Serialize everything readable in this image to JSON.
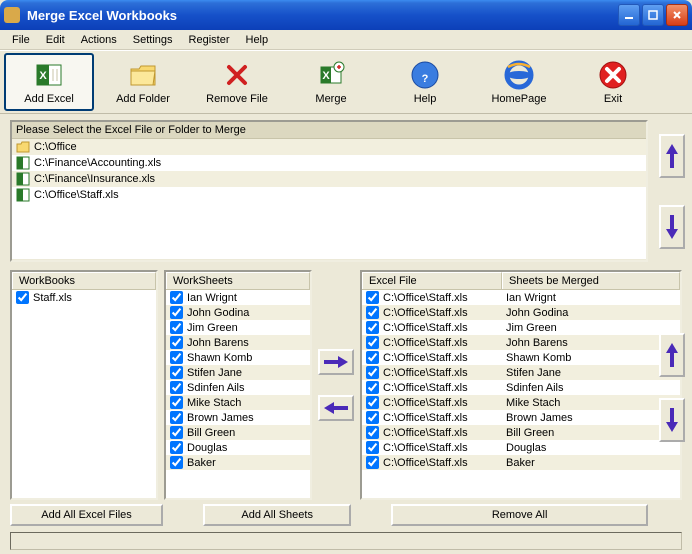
{
  "window": {
    "title": "Merge Excel Workbooks"
  },
  "menu": [
    "File",
    "Edit",
    "Actions",
    "Settings",
    "Register",
    "Help"
  ],
  "toolbar": [
    {
      "label": "Add Excel",
      "icon": "excel-add-icon"
    },
    {
      "label": "Add Folder",
      "icon": "folder-icon"
    },
    {
      "label": "Remove File",
      "icon": "remove-icon"
    },
    {
      "label": "Merge",
      "icon": "excel-merge-icon"
    },
    {
      "label": "Help",
      "icon": "help-icon"
    },
    {
      "label": "HomePage",
      "icon": "ie-icon"
    },
    {
      "label": "Exit",
      "icon": "exit-icon"
    }
  ],
  "file_panel": {
    "header": "Please Select the Excel File or Folder to Merge",
    "items": [
      {
        "label": "C:\\Office",
        "type": "folder"
      },
      {
        "label": "C:\\Finance\\Accounting.xls",
        "type": "xls"
      },
      {
        "label": "C:\\Finance\\Insurance.xls",
        "type": "xls"
      },
      {
        "label": "C:\\Office\\Staff.xls",
        "type": "xls"
      }
    ]
  },
  "workbooks": {
    "header": "WorkBooks",
    "items": [
      {
        "label": "Staff.xls",
        "checked": true
      }
    ]
  },
  "worksheets": {
    "header": "WorkSheets",
    "items": [
      {
        "label": "Ian Wrignt",
        "checked": true
      },
      {
        "label": "John Godina",
        "checked": true
      },
      {
        "label": "Jim Green",
        "checked": true
      },
      {
        "label": "John Barens",
        "checked": true
      },
      {
        "label": "Shawn Komb",
        "checked": true
      },
      {
        "label": "Stifen Jane",
        "checked": true
      },
      {
        "label": "Sdinfen Ails",
        "checked": true
      },
      {
        "label": "Mike Stach",
        "checked": true
      },
      {
        "label": "Brown James",
        "checked": true
      },
      {
        "label": "Bill Green",
        "checked": true
      },
      {
        "label": "Douglas",
        "checked": true
      },
      {
        "label": "Baker",
        "checked": true
      }
    ]
  },
  "merge": {
    "header_excel": "Excel File",
    "header_sheets": "Sheets be Merged",
    "items": [
      {
        "file": "C:\\Office\\Staff.xls",
        "sheet": "Ian Wrignt",
        "checked": true
      },
      {
        "file": "C:\\Office\\Staff.xls",
        "sheet": "John Godina",
        "checked": true
      },
      {
        "file": "C:\\Office\\Staff.xls",
        "sheet": "Jim Green",
        "checked": true
      },
      {
        "file": "C:\\Office\\Staff.xls",
        "sheet": "John Barens",
        "checked": true
      },
      {
        "file": "C:\\Office\\Staff.xls",
        "sheet": "Shawn Komb",
        "checked": true
      },
      {
        "file": "C:\\Office\\Staff.xls",
        "sheet": "Stifen Jane",
        "checked": true
      },
      {
        "file": "C:\\Office\\Staff.xls",
        "sheet": "Sdinfen Ails",
        "checked": true
      },
      {
        "file": "C:\\Office\\Staff.xls",
        "sheet": "Mike Stach",
        "checked": true
      },
      {
        "file": "C:\\Office\\Staff.xls",
        "sheet": "Brown James",
        "checked": true
      },
      {
        "file": "C:\\Office\\Staff.xls",
        "sheet": "Bill Green",
        "checked": true
      },
      {
        "file": "C:\\Office\\Staff.xls",
        "sheet": "Douglas",
        "checked": true
      },
      {
        "file": "C:\\Office\\Staff.xls",
        "sheet": "Baker",
        "checked": true
      }
    ]
  },
  "buttons": {
    "add_all_excel": "Add All Excel Files",
    "add_all_sheets": "Add All Sheets",
    "remove_all": "Remove All"
  }
}
